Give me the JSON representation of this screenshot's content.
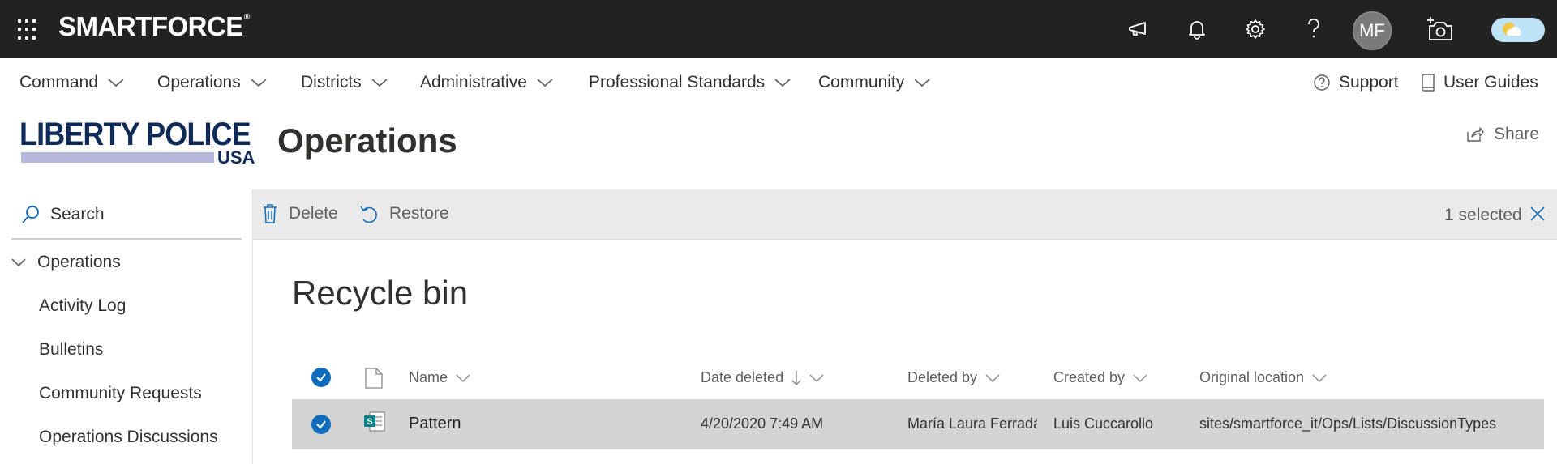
{
  "suite": {
    "brand": "SMARTFORCE",
    "brand_mark": "®",
    "avatar_initials": "MF",
    "icons": [
      "megaphone-icon",
      "bell-icon",
      "gear-icon",
      "help-icon",
      "camera-icon"
    ]
  },
  "hubnav": {
    "items": [
      {
        "label": "Command"
      },
      {
        "label": "Operations"
      },
      {
        "label": "Districts"
      },
      {
        "label": "Administrative"
      },
      {
        "label": "Professional Standards"
      },
      {
        "label": "Community"
      }
    ],
    "support": "Support",
    "user_guides": "User Guides"
  },
  "site": {
    "logo_line1": "LIBERTY POLICE",
    "logo_line2": "USA",
    "title": "Operations",
    "share": "Share"
  },
  "leftnav": {
    "search_placeholder": "Search",
    "group": "Operations",
    "items": [
      "Activity Log",
      "Bulletins",
      "Community Requests",
      "Operations Discussions"
    ]
  },
  "commandbar": {
    "delete": "Delete",
    "restore": "Restore",
    "selected": "1 selected"
  },
  "main": {
    "heading": "Recycle bin",
    "columns": {
      "name": "Name",
      "date_deleted": "Date deleted",
      "deleted_by": "Deleted by",
      "created_by": "Created by",
      "original_location": "Original location"
    },
    "rows": [
      {
        "name": "Pattern",
        "date_deleted": "4/20/2020 7:49 AM",
        "deleted_by": "María Laura Ferradás",
        "created_by": "Luis Cuccarollo",
        "original_location": "sites/smartforce_it/Ops/Lists/DiscussionTypes"
      }
    ]
  },
  "colors": {
    "suitebar": "#222222",
    "accent": "#0f6cbd",
    "commandbar": "#eaeaea",
    "selected_row": "#d4d4d4",
    "logo_navy": "#0e2a58"
  }
}
